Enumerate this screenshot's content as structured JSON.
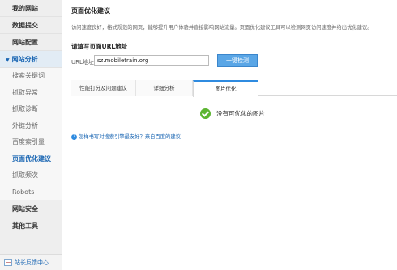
{
  "sidebar": {
    "sections_top": [
      {
        "label": "我的网站"
      },
      {
        "label": "数据提交"
      },
      {
        "label": "网站配置"
      }
    ],
    "active_section": {
      "label": "网站分析"
    },
    "sub_items": [
      {
        "label": "搜索关键词"
      },
      {
        "label": "抓取异常"
      },
      {
        "label": "抓取诊断"
      },
      {
        "label": "外链分析"
      },
      {
        "label": "百度索引量"
      },
      {
        "label": "页面优化建议"
      },
      {
        "label": "抓取频次"
      },
      {
        "label": "Robots"
      }
    ],
    "sections_bottom": [
      {
        "label": "网站安全"
      },
      {
        "label": "其他工具"
      }
    ],
    "feedback_label": "站长反馈中心"
  },
  "main": {
    "title": "页面优化建议",
    "description": "访问速度良好，格式规范的网页，能够提升用户体验并直接影响网站流量。页面优化建议工具可以检测网页访问速度并给出优化建议。",
    "section_label": "请填写页面URL地址",
    "url_label": "URL地址",
    "url_value": "sz.mobiletrain.org",
    "check_button": "一键检测",
    "tabs": [
      {
        "label": "性能打分及问题建议"
      },
      {
        "label": "详细分析"
      },
      {
        "label": "图片优化"
      }
    ],
    "active_tab": "图片优化",
    "result_text": "没有可优化的图片",
    "help_link": "怎样书写对搜索引擎最友好？来自百度的建议"
  },
  "colors": {
    "accent": "#2f8be0",
    "button": "#5aa6e6",
    "success": "#5cb531",
    "link": "#1a66b3"
  }
}
